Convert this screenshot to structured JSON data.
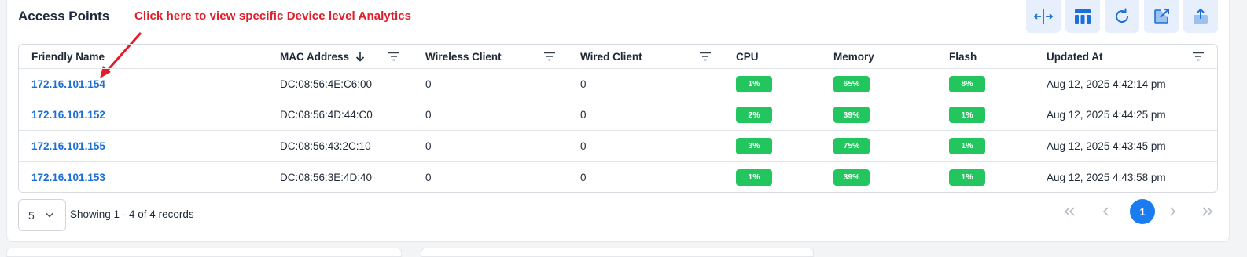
{
  "panel": {
    "title": "Access Points",
    "annotation": "Click here to view specific Device level Analytics",
    "annotation_color": "#e11d2a"
  },
  "toolbar": {
    "buttons": [
      {
        "icon": "columns-resize-icon"
      },
      {
        "icon": "table-layout-icon"
      },
      {
        "icon": "refresh-icon"
      },
      {
        "icon": "external-link-icon"
      },
      {
        "icon": "upload-icon"
      }
    ],
    "accent": "#1d6fd8"
  },
  "table": {
    "columns": [
      "Friendly Name",
      "MAC Address",
      "Wireless Client",
      "Wired Client",
      "CPU",
      "Memory",
      "Flash",
      "Updated At"
    ],
    "sort": {
      "column": "MAC Address",
      "direction": "descending"
    },
    "rows": [
      {
        "name": "172.16.101.154",
        "mac": "DC:08:56:4E:C6:00",
        "wireless": "0",
        "wired": "0",
        "cpu": "1%",
        "memory": "65%",
        "flash": "8%",
        "updated": "Aug 12, 2025 4:42:14 pm"
      },
      {
        "name": "172.16.101.152",
        "mac": "DC:08:56:4D:44:C0",
        "wireless": "0",
        "wired": "0",
        "cpu": "2%",
        "memory": "39%",
        "flash": "1%",
        "updated": "Aug 12, 2025 4:44:25 pm"
      },
      {
        "name": "172.16.101.155",
        "mac": "DC:08:56:43:2C:10",
        "wireless": "0",
        "wired": "0",
        "cpu": "3%",
        "memory": "75%",
        "flash": "1%",
        "updated": "Aug 12, 2025 4:43:45 pm"
      },
      {
        "name": "172.16.101.153",
        "mac": "DC:08:56:3E:4D:40",
        "wireless": "0",
        "wired": "0",
        "cpu": "1%",
        "memory": "39%",
        "flash": "1%",
        "updated": "Aug 12, 2025 4:43:58 pm"
      }
    ],
    "badge_color": "#22c55e",
    "link_color": "#1d6fd8"
  },
  "footer": {
    "page_size": "5",
    "showing": "Showing 1 - 4 of 4 records",
    "current_page": "1",
    "active_color": "#1a7cf0"
  }
}
